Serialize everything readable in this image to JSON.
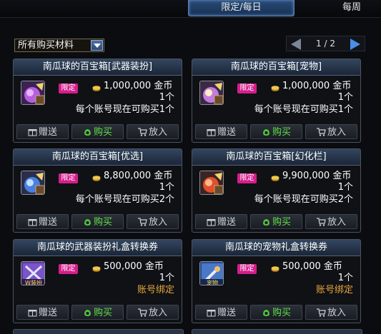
{
  "tabs": {
    "active": "限定/每日",
    "weekly": "每周"
  },
  "filter": {
    "label": "所有购买材料"
  },
  "pager": {
    "text": "1 / 2"
  },
  "currency": "金币",
  "buttons": {
    "gift": "赠送",
    "buy": "购买",
    "cart": "放入"
  },
  "limit_badge": "限定",
  "cards": [
    {
      "title": "南瓜球的百宝箱[武器装扮]",
      "price": "1,000,000",
      "qty": "1个",
      "note": "每个账号现在可购买1个",
      "icon": "pumpkin-box-purple-icon"
    },
    {
      "title": "南瓜球的百宝箱[宠物]",
      "price": "1,000,000",
      "qty": "1个",
      "note": "每个账号现在可购买1个",
      "icon": "pumpkin-box-gold-icon"
    },
    {
      "title": "南瓜球的百宝箱[优选]",
      "price": "8,800,000",
      "qty": "1个",
      "note": "每个账号现在可购买2个",
      "icon": "pumpkin-box-blue-icon"
    },
    {
      "title": "南瓜球的百宝箱[幻化栏]",
      "price": "9,900,000",
      "qty": "1个",
      "note": "每个账号现在可购买2个",
      "icon": "pumpkin-box-red-icon"
    },
    {
      "title": "南瓜球的武器装扮礼盒转换券",
      "price": "500,000",
      "qty": "1个",
      "note": "账号绑定",
      "icon": "weapon-coupon-icon",
      "icon_text": "W装扮"
    },
    {
      "title": "南瓜球的宠物礼盒转换券",
      "price": "500,000",
      "qty": "1个",
      "note": "账号绑定",
      "icon": "pet-coupon-icon",
      "icon_text": "宠物"
    }
  ],
  "colors": {
    "limit_badge": "#d41e8c",
    "bind_note": "#e8a63a",
    "buy_text": "#5fe04a",
    "title_bar": "#2a3a52"
  }
}
